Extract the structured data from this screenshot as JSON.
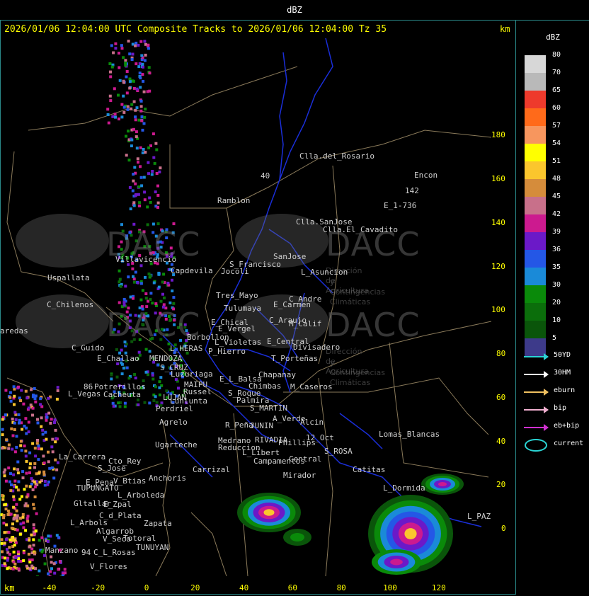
{
  "window_title": "dBZ",
  "header": {
    "text": "2026/01/06 12:04:00 UTC Composite Tracks to 2026/01/06 12:04:00 Tz 35",
    "km_top": "km",
    "km_bottom": "km"
  },
  "axes": {
    "y_ticks": [
      {
        "label": "180",
        "value": 180
      },
      {
        "label": "160",
        "value": 160
      },
      {
        "label": "140",
        "value": 140
      },
      {
        "label": "120",
        "value": 120
      },
      {
        "label": "100",
        "value": 100
      },
      {
        "label": "80",
        "value": 80
      },
      {
        "label": "60",
        "value": 60
      },
      {
        "label": "40",
        "value": 40
      },
      {
        "label": "20",
        "value": 20
      },
      {
        "label": "0",
        "value": 0
      }
    ],
    "x_ticks": [
      {
        "label": "-40",
        "value": -40
      },
      {
        "label": "-20",
        "value": -20
      },
      {
        "label": "0",
        "value": 0
      },
      {
        "label": "20",
        "value": 20
      },
      {
        "label": "40",
        "value": 40
      },
      {
        "label": "60",
        "value": 60
      },
      {
        "label": "80",
        "value": 80
      },
      {
        "label": "100",
        "value": 100
      },
      {
        "label": "120",
        "value": 120
      }
    ]
  },
  "legend": {
    "title": "dBZ",
    "scale": [
      {
        "label": "80",
        "color": "#d7d7d7"
      },
      {
        "label": "70",
        "color": "#b9b9b9"
      },
      {
        "label": "65",
        "color": "#ee3a2c"
      },
      {
        "label": "60",
        "color": "#ff6a1a"
      },
      {
        "label": "57",
        "color": "#f7965e"
      },
      {
        "label": "54",
        "color": "#ffff00"
      },
      {
        "label": "51",
        "color": "#fbc62d"
      },
      {
        "label": "48",
        "color": "#d58c3b"
      },
      {
        "label": "45",
        "color": "#c8708a"
      },
      {
        "label": "42",
        "color": "#cc1a8f"
      },
      {
        "label": "39",
        "color": "#6b19c8"
      },
      {
        "label": "36",
        "color": "#2457e6"
      },
      {
        "label": "35",
        "color": "#1a8ad8"
      },
      {
        "label": "30",
        "color": "#0a8a0a"
      },
      {
        "label": "20",
        "color": "#0b6e0b"
      },
      {
        "label": "10",
        "color": "#0a550a"
      },
      {
        "label": "5",
        "color": "#3d3a8a"
      }
    ],
    "tracks": [
      {
        "label": "50YD",
        "color": "#2ad4d4"
      },
      {
        "label": "30HM",
        "color": "#ffffff"
      },
      {
        "label": "eburn",
        "color": "#f0c060"
      },
      {
        "label": "bip",
        "color": "#f0b0d0"
      },
      {
        "label": "eb+bip",
        "color": "#d030d0"
      },
      {
        "label": "current",
        "color": "#2ad4d4"
      }
    ]
  },
  "watermark": {
    "brand": "DACC",
    "line1": "Dirección de Agricultura",
    "line2": "y Contingencias Climáticas"
  },
  "places": [
    {
      "name": "Clla.del_Rosario"
    },
    {
      "name": "Encon"
    },
    {
      "name": "Ramblon"
    },
    {
      "name": "E_1-736"
    },
    {
      "name": "142"
    },
    {
      "name": "Clla.SanJose"
    },
    {
      "name": "Clla.El_Cavadito"
    },
    {
      "name": "Villavicencio"
    },
    {
      "name": "Capdevila"
    },
    {
      "name": "S_Francisco"
    },
    {
      "name": "SanJose"
    },
    {
      "name": "Jocoli"
    },
    {
      "name": "L_Asuncion"
    },
    {
      "name": "Uspallata"
    },
    {
      "name": "Tres_Mayo"
    },
    {
      "name": "C_Andre"
    },
    {
      "name": "Tulumaya"
    },
    {
      "name": "E_Carmen"
    },
    {
      "name": "C_Chilenos"
    },
    {
      "name": "E_Chical"
    },
    {
      "name": "C_Araujo"
    },
    {
      "name": "E_Vergel"
    },
    {
      "name": "M_Calif"
    },
    {
      "name": "aredas"
    },
    {
      "name": "Borbollon"
    },
    {
      "name": "L_Violetas"
    },
    {
      "name": "E_Central"
    },
    {
      "name": "L_HERAS"
    },
    {
      "name": "P_Hierro"
    },
    {
      "name": "Divisadero"
    },
    {
      "name": "C_Guido"
    },
    {
      "name": "E_Challao"
    },
    {
      "name": "MENDOZA"
    },
    {
      "name": "T_Porteñas"
    },
    {
      "name": "S_CRUZ"
    },
    {
      "name": "Luzuriaga"
    },
    {
      "name": "Chapanay"
    },
    {
      "name": "MAIPU"
    },
    {
      "name": "E_L_Balsa"
    },
    {
      "name": "Potrerillos"
    },
    {
      "name": "Russel"
    },
    {
      "name": "Chimbas"
    },
    {
      "name": "M_Caseros"
    },
    {
      "name": "L_Vegas"
    },
    {
      "name": "Cacheuta"
    },
    {
      "name": "LUJAN"
    },
    {
      "name": "S_Roque"
    },
    {
      "name": "Lunlunta"
    },
    {
      "name": "Palmira"
    },
    {
      "name": "Perdriel"
    },
    {
      "name": "S_MARTIN"
    },
    {
      "name": "A_Verde"
    },
    {
      "name": "Alcin"
    },
    {
      "name": "Agrelo"
    },
    {
      "name": "R_Peña"
    },
    {
      "name": "JUNIN"
    },
    {
      "name": "Lomas_Blancas"
    },
    {
      "name": "Medrano"
    },
    {
      "name": "RIVADIA"
    },
    {
      "name": "12_Oct"
    },
    {
      "name": "Ugarteche"
    },
    {
      "name": "Phillips"
    },
    {
      "name": "Reduccion"
    },
    {
      "name": "S_ROSA"
    },
    {
      "name": "L_Libert"
    },
    {
      "name": "La_Carrera"
    },
    {
      "name": "Cto_Rey"
    },
    {
      "name": "Campamentos"
    },
    {
      "name": "Central"
    },
    {
      "name": "Carrizal"
    },
    {
      "name": "Catitas"
    },
    {
      "name": "S_Jose"
    },
    {
      "name": "Anchoris"
    },
    {
      "name": "Mirador"
    },
    {
      "name": "E_Pena"
    },
    {
      "name": "V_Btias"
    },
    {
      "name": "TUPUNGATO"
    },
    {
      "name": "L_Dormida"
    },
    {
      "name": "L_Arboleda"
    },
    {
      "name": "Gltallar"
    },
    {
      "name": "E_Zpal"
    },
    {
      "name": "L_PAZ"
    },
    {
      "name": "C_d_Plata"
    },
    {
      "name": "L_Arbols"
    },
    {
      "name": "Zapata"
    },
    {
      "name": "Algarrob"
    },
    {
      "name": "V_Seco"
    },
    {
      "name": "Totoral"
    },
    {
      "name": "TUNUYAN"
    },
    {
      "name": "Manzano"
    },
    {
      "name": "C_L_Rosas"
    },
    {
      "name": "V_Flores"
    },
    {
      "name": "86"
    },
    {
      "name": "40"
    },
    {
      "name": "94"
    }
  ]
}
